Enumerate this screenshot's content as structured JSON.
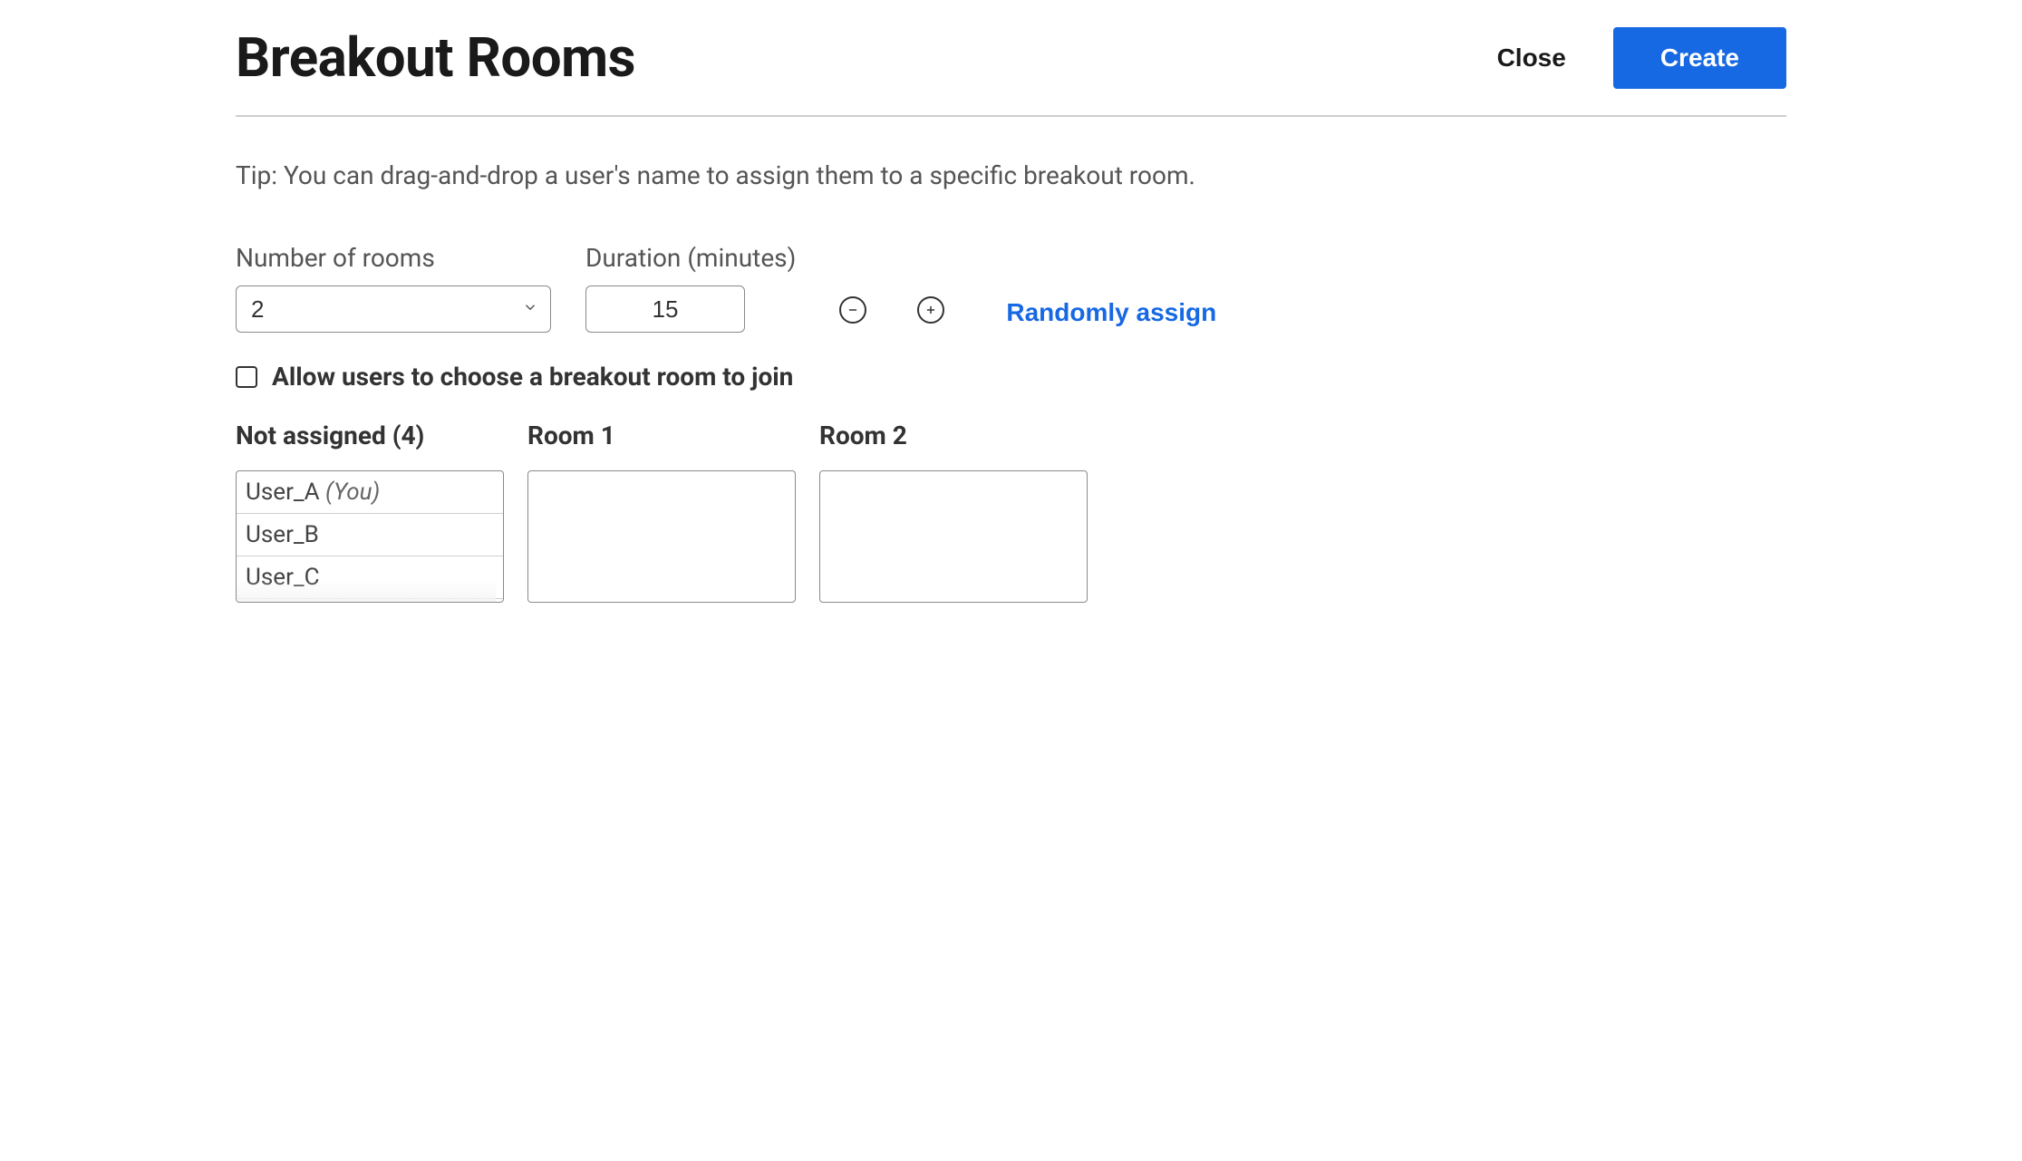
{
  "header": {
    "title": "Breakout Rooms",
    "close_label": "Close",
    "create_label": "Create"
  },
  "tip_text": "Tip: You can drag-and-drop a user's name to assign them to a specific breakout room.",
  "controls": {
    "rooms_label": "Number of rooms",
    "rooms_value": "2",
    "duration_label": "Duration (minutes)",
    "duration_value": "15",
    "random_assign_label": "Randomly assign"
  },
  "allow_choose": {
    "checked": false,
    "label": "Allow users to choose a breakout room to join"
  },
  "columns": {
    "not_assigned": {
      "header": "Not assigned (4)",
      "users": [
        {
          "name": "User_A",
          "you_suffix": "(You)"
        },
        {
          "name": "User_B"
        },
        {
          "name": "User_C"
        }
      ]
    },
    "room1": {
      "header": "Room 1"
    },
    "room2": {
      "header": "Room 2"
    }
  }
}
